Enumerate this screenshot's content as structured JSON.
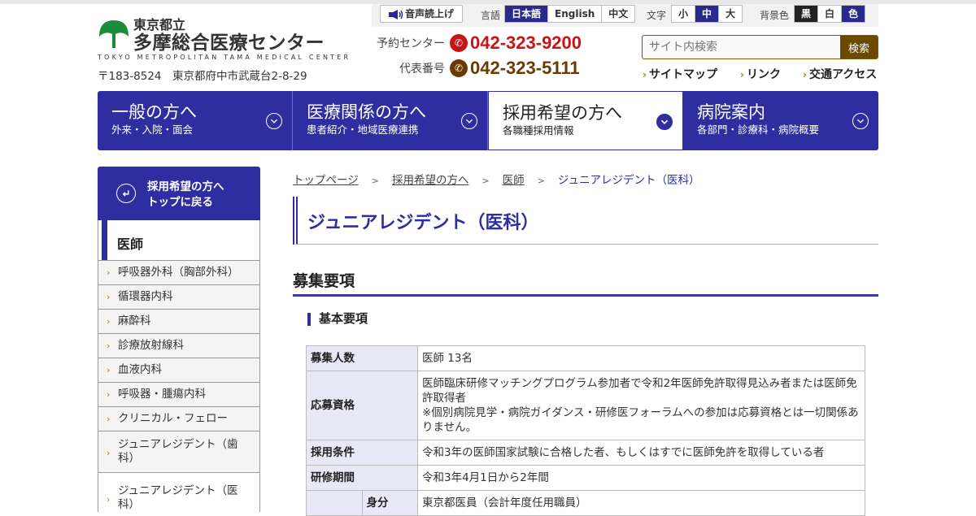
{
  "header": {
    "logo_sub": "東京都立",
    "logo_main": "多摩総合医療センター",
    "logo_en": "TOKYO METROPOLITAN TAMA MEDICAL CENTER",
    "address": "〒183-8524　東京都府中市武蔵台2-8-29"
  },
  "util": {
    "voice_label": "音声読上げ",
    "lang_label": "言語",
    "languages": [
      "日本語",
      "English",
      "中文"
    ],
    "text_label": "文字",
    "text_sizes": [
      "小",
      "中",
      "大"
    ],
    "bg_label": "背景色",
    "bg_options": [
      "黒",
      "白",
      "色"
    ]
  },
  "phones": [
    {
      "label": "予約センター",
      "number": "042-323-9200",
      "color": "#c81414"
    },
    {
      "label": "代表番号",
      "number": "042-323-5111",
      "color": "#6b3a00"
    }
  ],
  "search": {
    "placeholder": "サイト内検索",
    "button": "検索"
  },
  "quick_links": [
    "サイトマップ",
    "リンク",
    "交通アクセス"
  ],
  "global_nav": [
    {
      "title": "一般の方へ",
      "sub": "外来・入院・面会"
    },
    {
      "title": "医療関係の方へ",
      "sub": "患者紹介・地域医療連携"
    },
    {
      "title": "採用希望の方へ",
      "sub": "各職種採用情報"
    },
    {
      "title": "病院案内",
      "sub": "各部門・診療科・病院概要"
    }
  ],
  "sidebar": {
    "back_line1": "採用希望の方へ",
    "back_line2": "トップに戻る",
    "heading": "医師",
    "items": [
      "呼吸器外科（胸部外科）",
      "循環器内科",
      "麻酔科",
      "診療放射線科",
      "血液内科",
      "呼吸器・腫瘍内科",
      "クリニカル・フェロー",
      "ジュニアレジデント（歯科）",
      "ジュニアレジデント（医科）"
    ]
  },
  "breadcrumb": [
    "トップページ",
    "採用希望の方へ",
    "医師",
    "ジュニアレジデント（医科）"
  ],
  "page_title": "ジュニアレジデント（医科）",
  "section_title": "募集要項",
  "subsection_title": "基本要項",
  "table": {
    "rows": [
      {
        "label": "募集人数",
        "value": "医師 13名"
      },
      {
        "label": "応募資格",
        "value": "医師臨床研修マッチングプログラム参加者で令和2年医師免許取得見込み者または医師免許取得者",
        "value2": "※個別病院見学・病院ガイダンス・研修医フォーラムへの参加は応募資格とは一切関係ありません。"
      },
      {
        "label": "採用条件",
        "value": "令和3年の医師国家試験に合格した者、もしくはすでに医師免許を取得している者"
      },
      {
        "label": "研修期間",
        "value": "令和3年4月1日から2年間"
      }
    ],
    "status_sub_label": "身分",
    "status_value": "東京都医員（会計年度任用職員）"
  }
}
